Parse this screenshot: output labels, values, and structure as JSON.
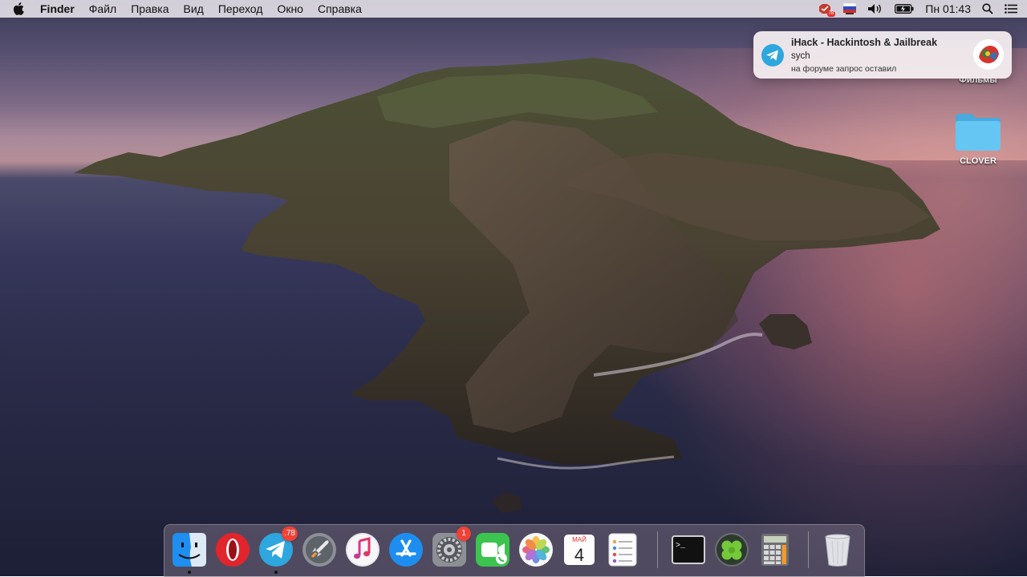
{
  "menubar": {
    "app_name": "Finder",
    "items": [
      "Файл",
      "Правка",
      "Вид",
      "Переход",
      "Окно",
      "Справка"
    ],
    "status": {
      "antivirus_badge": "78",
      "clock": "Пн 01:43"
    }
  },
  "notification": {
    "title": "iHack - Hackintosh & Jailbreak",
    "sender": "sych",
    "body": "на форуме запрос оставил"
  },
  "desktop": {
    "items": [
      {
        "label": "Фильмы"
      },
      {
        "label": "CLOVER"
      }
    ]
  },
  "dock": {
    "apps": [
      {
        "name": "Finder",
        "running": true
      },
      {
        "name": "Opera",
        "running": false
      },
      {
        "name": "Telegram",
        "badge": ".78",
        "running": true
      },
      {
        "name": "Launchpad",
        "running": false
      },
      {
        "name": "iTunes",
        "running": false
      },
      {
        "name": "App Store",
        "running": false
      },
      {
        "name": "System Preferences",
        "badge": "1",
        "running": false
      },
      {
        "name": "FaceTime",
        "running": false
      },
      {
        "name": "Photos",
        "running": false
      },
      {
        "name": "Calendar",
        "month": "МАЙ",
        "day": "4",
        "running": false
      },
      {
        "name": "Reminders",
        "running": false
      },
      {
        "name": "Terminal",
        "prompt": ">_",
        "running": false
      },
      {
        "name": "Clover Configurator",
        "running": false
      },
      {
        "name": "Calculator",
        "running": false
      },
      {
        "name": "Trash",
        "running": false
      }
    ]
  },
  "colors": {
    "badge_red": "#f04136",
    "folder_blue": "#5ec1f0",
    "telegram_blue": "#2ea6de"
  }
}
